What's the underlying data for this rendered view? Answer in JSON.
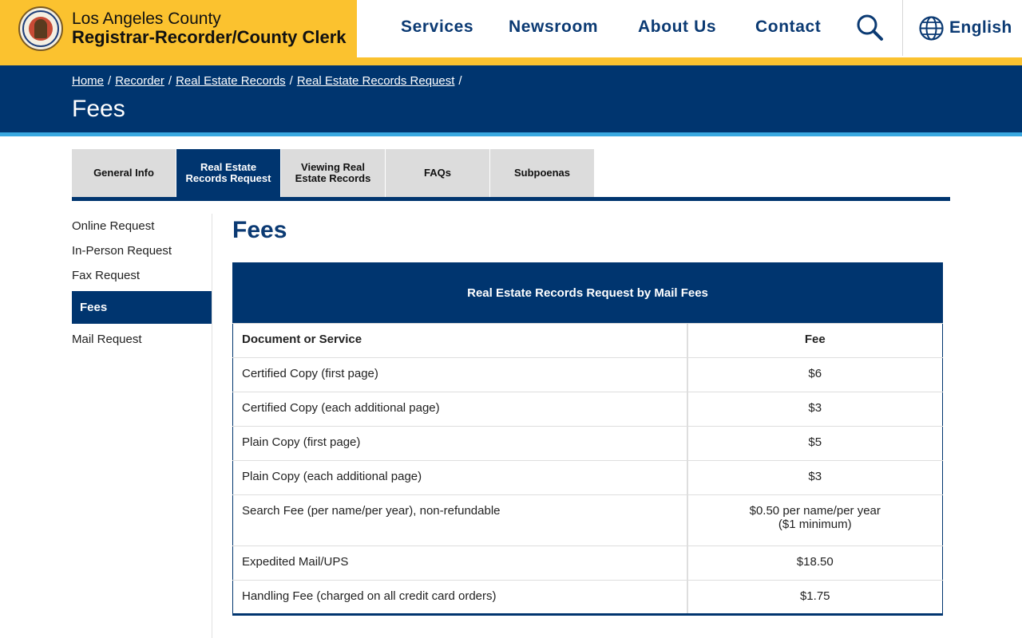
{
  "header": {
    "brand_line1": "Los Angeles County",
    "brand_line2": "Registrar-Recorder/County Clerk",
    "nav": {
      "services": "Services",
      "newsroom": "Newsroom",
      "about": "About Us",
      "contact": "Contact"
    },
    "language": "English"
  },
  "breadcrumb": {
    "items": [
      "Home",
      "Recorder",
      "Real Estate Records",
      "Real Estate Records Request"
    ],
    "separator": "/"
  },
  "page_title": "Fees",
  "tabs": [
    {
      "label": "General Info"
    },
    {
      "label": "Real Estate Records Request"
    },
    {
      "label": "Viewing Real Estate Records"
    },
    {
      "label": "FAQs"
    },
    {
      "label": "Subpoenas"
    }
  ],
  "sidenav": [
    {
      "label": "Online Request"
    },
    {
      "label": "In-Person Request"
    },
    {
      "label": "Fax Request"
    },
    {
      "label": "Fees"
    },
    {
      "label": "Mail Request"
    }
  ],
  "content": {
    "title": "Fees",
    "table": {
      "caption": "Real Estate Records Request by Mail Fees",
      "col_document": "Document or Service",
      "col_fee": "Fee",
      "rows": [
        {
          "service": "Certified Copy (first page)",
          "fee": "$6"
        },
        {
          "service": "Certified Copy (each additional page)",
          "fee": "$3"
        },
        {
          "service": "Plain Copy (first page)",
          "fee": "$5"
        },
        {
          "service": "Plain Copy (each additional page)",
          "fee": "$3"
        },
        {
          "service": "Search Fee (per name/per year), non-refundable",
          "fee": "$0.50 per name/per year",
          "fee_note": "($1 minimum)"
        },
        {
          "service": "Expedited Mail/UPS",
          "fee": "$18.50"
        },
        {
          "service": "Handling Fee (charged on all credit card orders)",
          "fee": "$1.75"
        }
      ]
    }
  },
  "colors": {
    "brand_yellow": "#fbc22f",
    "navy": "#00356f",
    "accent_blue": "#39a8e0"
  }
}
